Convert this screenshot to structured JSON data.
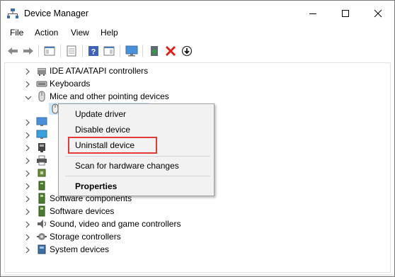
{
  "window": {
    "title": "Device Manager"
  },
  "menu": [
    "File",
    "Action",
    "View",
    "Help"
  ],
  "toolbar": {
    "icons": [
      "back-arrow-icon",
      "forward-arrow-icon",
      "show-hide-console-tree-icon",
      "properties-sheet-icon",
      "help-icon",
      "action-pane-icon",
      "scan-monitor-icon",
      "update-driver-icon",
      "uninstall-x-icon",
      "disable-device-icon"
    ],
    "accent_red": "#e02020",
    "accent_green": "#2e9e3e"
  },
  "tree": {
    "rows": [
      {
        "label": "IDE ATA/ATAPI controllers",
        "expanded": false,
        "icon": "ide-controller-icon"
      },
      {
        "label": "Keyboards",
        "expanded": false,
        "icon": "keyboard-icon"
      },
      {
        "label": "Mice and other pointing devices",
        "expanded": true,
        "icon": "mouse-icon"
      },
      {
        "label": "",
        "expanded": false,
        "icon": "monitor-icon"
      },
      {
        "label": "",
        "expanded": false,
        "icon": "monitors-icon"
      },
      {
        "label": "",
        "expanded": false,
        "icon": "network-adapter-icon"
      },
      {
        "label": "",
        "expanded": false,
        "icon": "print-queue-icon"
      },
      {
        "label": "",
        "expanded": false,
        "icon": "processor-icon"
      },
      {
        "label": "",
        "expanded": false,
        "icon": "security-device-icon"
      },
      {
        "label": "Software components",
        "expanded": false,
        "icon": "software-components-icon"
      },
      {
        "label": "Software devices",
        "expanded": false,
        "icon": "software-devices-icon"
      },
      {
        "label": "Sound, video and game controllers",
        "expanded": false,
        "icon": "sound-icon"
      },
      {
        "label": "Storage controllers",
        "expanded": false,
        "icon": "storage-icon"
      },
      {
        "label": "System devices",
        "expanded": false,
        "icon": "system-devices-icon"
      }
    ]
  },
  "context_menu": {
    "items": [
      "Update driver",
      "Disable device",
      "Uninstall device",
      "Scan for hardware changes",
      "Properties"
    ],
    "highlighted": "Uninstall device",
    "highlight_color": "#e53935"
  }
}
